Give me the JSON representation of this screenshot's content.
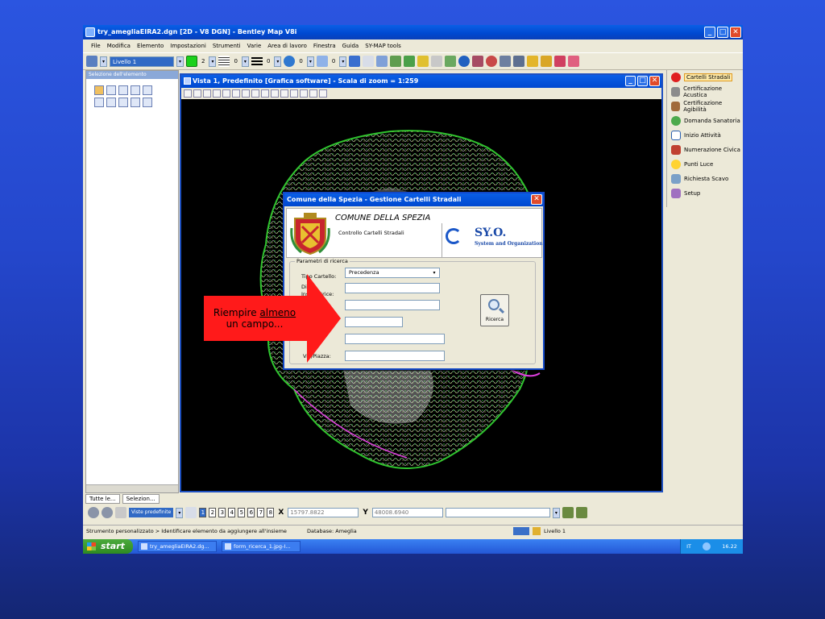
{
  "window": {
    "title": "try_amegliaEIRA2.dgn [2D - V8 DGN] - Bentley Map V8i"
  },
  "menu": [
    "File",
    "Modifica",
    "Elemento",
    "Impostazioni",
    "Strumenti",
    "Varie",
    "Area di lavoro",
    "Finestra",
    "Guida",
    "SY-MAP tools"
  ],
  "toolbar": {
    "level": "Livello 1",
    "color_index": "2",
    "style_index": "0",
    "weight_index": "0",
    "tr_index": "0",
    "prio_index": "0"
  },
  "left_panel": {
    "title": "Selezione dell'elemento",
    "tabs": [
      "Tutte le...",
      "Selezion..."
    ]
  },
  "view": {
    "title": "Vista 1, Predefinito [Grafica software] - Scala di zoom = 1:259"
  },
  "right_panel": {
    "items": [
      "Cartelli Stradali",
      "Certificazione Acustica",
      "Certificazione Agibilità",
      "Domanda Sanatoria",
      "Inizio Attività",
      "Numerazione Civica",
      "Punti Luce",
      "Richiesta Scavo",
      "Setup"
    ]
  },
  "bottom": {
    "views_label": "Viste predefinite",
    "view_numbers": [
      "1",
      "2",
      "3",
      "4",
      "5",
      "6",
      "7",
      "8"
    ],
    "x_label": "X",
    "x_value": "15797.8822",
    "y_label": "Y",
    "y_value": "48008.6940"
  },
  "status": {
    "message": "Strumento personalizzato > Identificare elemento da aggiungere all'insieme",
    "database": "Database: Ameglia",
    "level": "Livello 1"
  },
  "taskbar": {
    "start": "start",
    "tasks": [
      "try_amegliaEIRA2.dg...",
      "form_ricerca_1.jpg-I..."
    ],
    "lang": "IT",
    "time": "16.22"
  },
  "dialog": {
    "title": "Comune della Spezia - Gestione Cartelli Stradali",
    "comune": "COMUNE DELLA SPEZIA",
    "subtitle": "Controllo Cartelli Stradali",
    "syo_big": "SY.O.",
    "syo_small": "System and Organization",
    "legend": "Parametri di ricerca",
    "label_tipo": "Tipo Cartello:",
    "tipo_value": "Precedenza",
    "label_ditta_1": "Di",
    "label_ditta_2": "Installatrice:",
    "label_via": "Via/Piazza:",
    "button_ricerca": "Ricerca"
  },
  "annotation": {
    "line1": "Riempire ",
    "underlined": "almeno",
    "line2": "un campo..."
  },
  "colors": {
    "accent": "#0a5fe6",
    "arrow": "#ff1a1a",
    "background": "#2447cc"
  }
}
